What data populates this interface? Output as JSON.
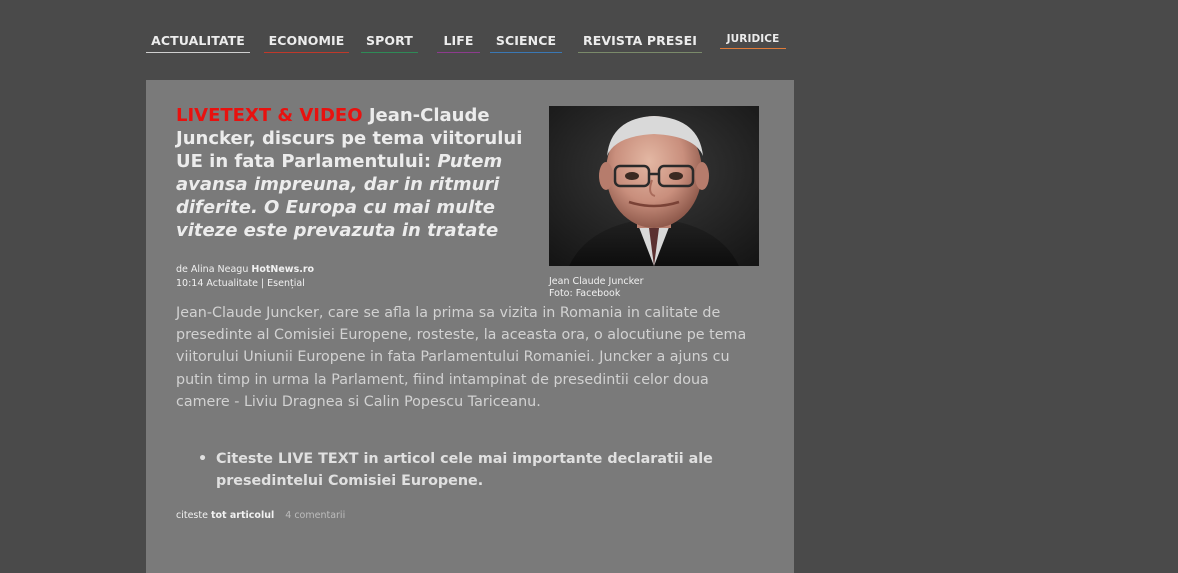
{
  "nav": {
    "items": [
      {
        "label": "ACTUALITATE",
        "color": "#cfcfcf"
      },
      {
        "label": "ECONOMIE",
        "color": "#c0392b"
      },
      {
        "label": "SPORT",
        "color": "#2e8b57"
      },
      {
        "label": "LIFE",
        "color": "#8e3b8e"
      },
      {
        "label": "SCIENCE",
        "color": "#3a78b5"
      },
      {
        "label": "REVISTA PRESEI",
        "color": "#7a8a6a"
      },
      {
        "label": "JURIDICE",
        "color": "#e07b39"
      }
    ]
  },
  "article": {
    "kicker": "LIVETEXT & VIDEO",
    "title": "Jean-Claude Juncker, discurs pe tema viitorului UE in fata Parlamentului:",
    "quote": "Putem avansa impreuna, dar in ritmuri diferite. O Europa cu mai multe viteze este prevazuta in tratate",
    "byline": {
      "prefix": "de Alina Neagu",
      "source": "HotNews.ro",
      "time_section": "10:14 Actualitate | Esențial"
    },
    "image": {
      "alt": "Jean Claude Juncker",
      "caption_name": "Jean Claude Juncker",
      "caption_credit": "Foto: Facebook"
    },
    "body": "Jean-Claude Juncker, care se afla la prima sa vizita in Romania in calitate de presedinte al Comisiei Europene, rosteste, la aceasta ora, o alocutiune pe tema viitorului Uniunii Europene in fata Parlamentului Romaniei. Juncker a ajuns cu putin timp in urma la Parlament, fiind intampinat de presedintii celor doua camere - Liviu Dragnea si Calin Popescu Tariceanu.",
    "bullet": "Citeste LIVE TEXT in articol cele mai importante declaratii ale presedintelui Comisiei Europene.",
    "read_more_prefix": "citeste",
    "read_more_link": "tot articolul",
    "comments": "4 comentarii"
  },
  "colors": {
    "background": "#4a4a4a",
    "card": "#7a7a7a",
    "kicker": "#e8110f"
  }
}
